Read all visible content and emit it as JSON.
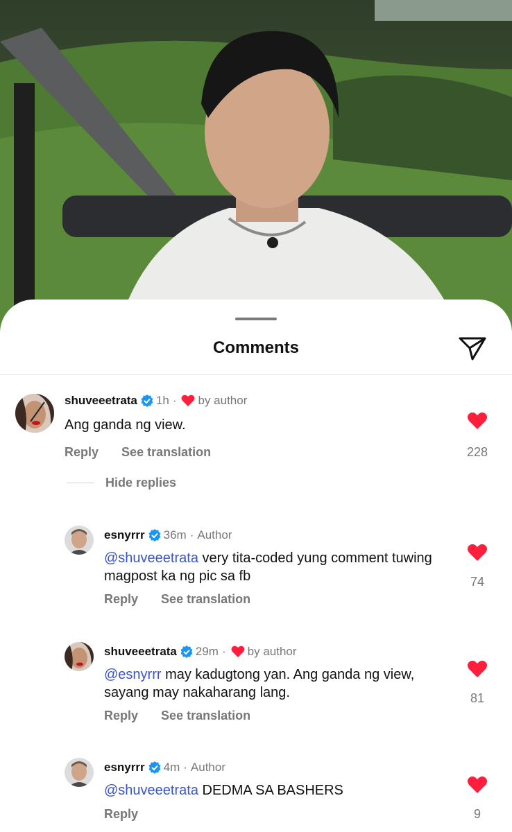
{
  "sheet": {
    "title": "Comments"
  },
  "comments": [
    {
      "username": "shuveeetrata",
      "time": "1h",
      "sep": "·",
      "badge": "by author",
      "text": "Ang ganda ng view.",
      "reply_label": "Reply",
      "translate_label": "See translation",
      "likes": "228"
    },
    {
      "username": "esnyrrr",
      "time": "36m",
      "sep": "·",
      "badge": "Author",
      "mention": "@shuveeetrata",
      "text": "very tita-coded yung comment tuwing magpost ka ng pic sa fb",
      "reply_label": "Reply",
      "translate_label": "See translation",
      "likes": "74"
    },
    {
      "username": "shuveeetrata",
      "time": "29m",
      "sep": "·",
      "badge": "by author",
      "mention": "@esnyrrr",
      "text": "may kadugtong yan. Ang ganda ng view, sayang may nakaharang lang.",
      "reply_label": "Reply",
      "translate_label": "See translation",
      "likes": "81"
    },
    {
      "username": "esnyrrr",
      "time": "4m",
      "sep": "·",
      "badge": "Author",
      "mention": "@shuveeetrata",
      "text": "DEDMA SA BASHERS",
      "reply_label": "Reply",
      "likes": "9"
    }
  ],
  "hide_replies_label": "Hide replies",
  "colors": {
    "heart": "#ff1f3d",
    "verified": "#1b95f5",
    "mention": "#3a55c8"
  }
}
